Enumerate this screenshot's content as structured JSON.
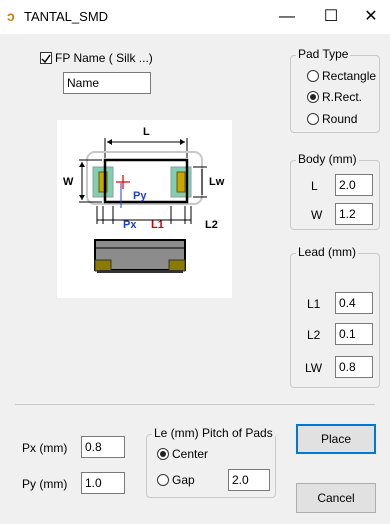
{
  "window": {
    "title": "TANTAL_SMD",
    "minimize": "—",
    "maximize": "☐",
    "close": "✕"
  },
  "fp_name": {
    "label": "FP Name ( Silk ...)",
    "checked": true,
    "value": "Name"
  },
  "pad_type": {
    "legend": "Pad Type",
    "options": [
      "Rectangle",
      "R.Rect.",
      "Round"
    ],
    "selected": "R.Rect."
  },
  "body": {
    "legend": "Body (mm)",
    "L_label": "L",
    "L_value": "2.0",
    "W_label": "W",
    "W_value": "1.2"
  },
  "lead": {
    "legend": "Lead (mm)",
    "L1_label": "L1",
    "L1_value": "0.4",
    "L2_label": "L2",
    "L2_value": "0.1",
    "LW_label": "LW",
    "LW_value": "0.8"
  },
  "diagram": {
    "L": "L",
    "W": "W",
    "Lw": "Lw",
    "Py": "Py",
    "Px": "Px",
    "L1": "L1",
    "L2": "L2"
  },
  "px": {
    "label": "Px (mm)",
    "value": "0.8"
  },
  "py": {
    "label": "Py (mm)",
    "value": "1.0"
  },
  "pitch": {
    "legend": "Le (mm)  Pitch of Pads",
    "options": [
      "Center",
      "Gap"
    ],
    "selected": "Center",
    "value": "2.0"
  },
  "buttons": {
    "place": "Place",
    "cancel": "Cancel"
  }
}
